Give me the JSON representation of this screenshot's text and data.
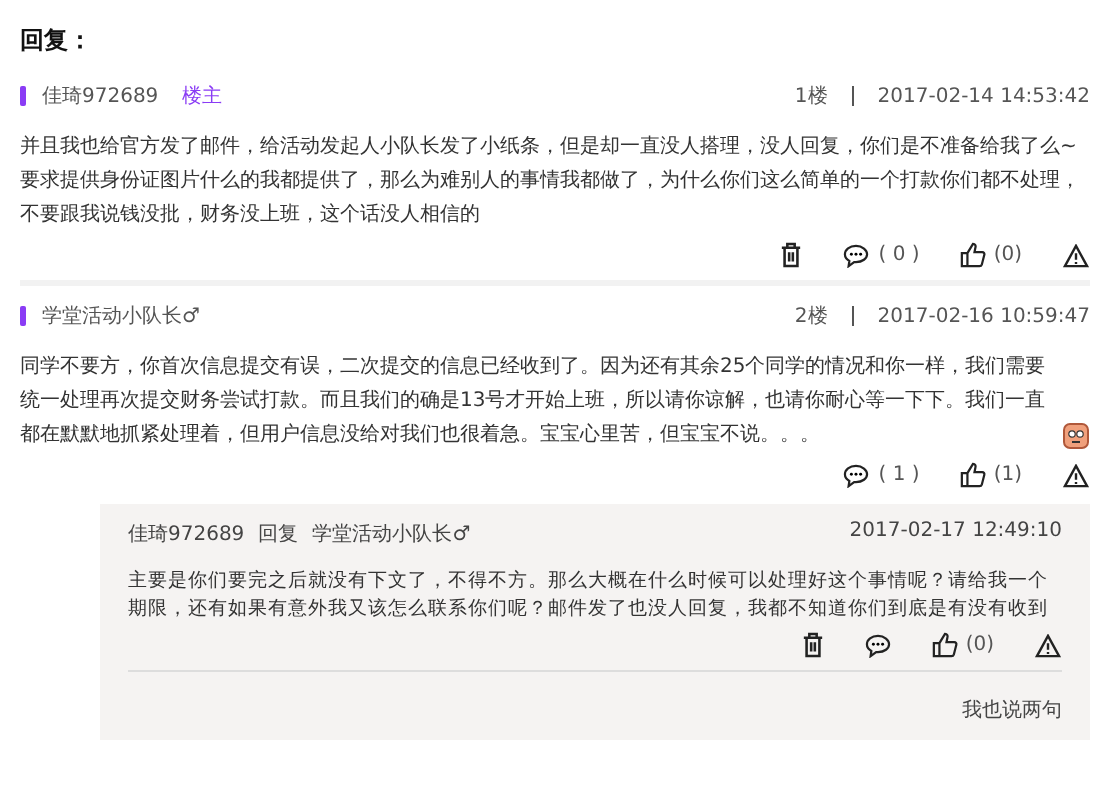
{
  "heading": "回复：",
  "posts": [
    {
      "author": "佳琦972689",
      "tag": "楼主",
      "floor": "1楼",
      "date": "2017-02-14 14:53:42",
      "body": "并且我也给官方发了邮件，给活动发起人小队长发了小纸条，但是却一直没人搭理，没人回复，你们是不准备给我了么~要求提供身份证图片什么的我都提供了，那么为难别人的事情我都做了，为什么你们这么简单的一个打款你们都不处理，不要跟我说钱没批，财务没上班，这个话没人相信的",
      "emoji": false,
      "actions": [
        {
          "kind": "delete"
        },
        {
          "kind": "comment",
          "count": "( 0 )"
        },
        {
          "kind": "like",
          "count": "(0)"
        },
        {
          "kind": "report"
        }
      ]
    },
    {
      "author": "学堂活动小队长♂",
      "floor": "2楼",
      "date": "2017-02-16 10:59:47",
      "body": "同学不要方，你首次信息提交有误，二次提交的信息已经收到了。因为还有其余25个同学的情况和你一样，我们需要统一处理再次提交财务尝试打款。而且我们的确是13号才开始上班，所以请你谅解，也请你耐心等一下下。我们一直都在默默地抓紧处理着，但用户信息没给对我们也很着急。宝宝心里苦，但宝宝不说。。。",
      "emoji": true,
      "actions": [
        {
          "kind": "comment",
          "count": "( 1 )"
        },
        {
          "kind": "like",
          "count": "(1)"
        },
        {
          "kind": "report"
        }
      ],
      "replies": [
        {
          "author": "佳琦972689",
          "verb": "回复",
          "target": "学堂活动小队长♂",
          "date": "2017-02-17 12:49:10",
          "body": "主要是你们要完之后就没有下文了，不得不方。那么大概在什么时候可以处理好这个事情呢？请给我一个期限，还有如果有意外我又该怎么联系你们呢？邮件发了也没人回复，我都不知道你们到底是有没有收到",
          "actions": [
            {
              "kind": "delete"
            },
            {
              "kind": "comment"
            },
            {
              "kind": "like",
              "count": "(0)"
            },
            {
              "kind": "report"
            }
          ]
        }
      ],
      "reply_link": "我也说两句"
    }
  ]
}
